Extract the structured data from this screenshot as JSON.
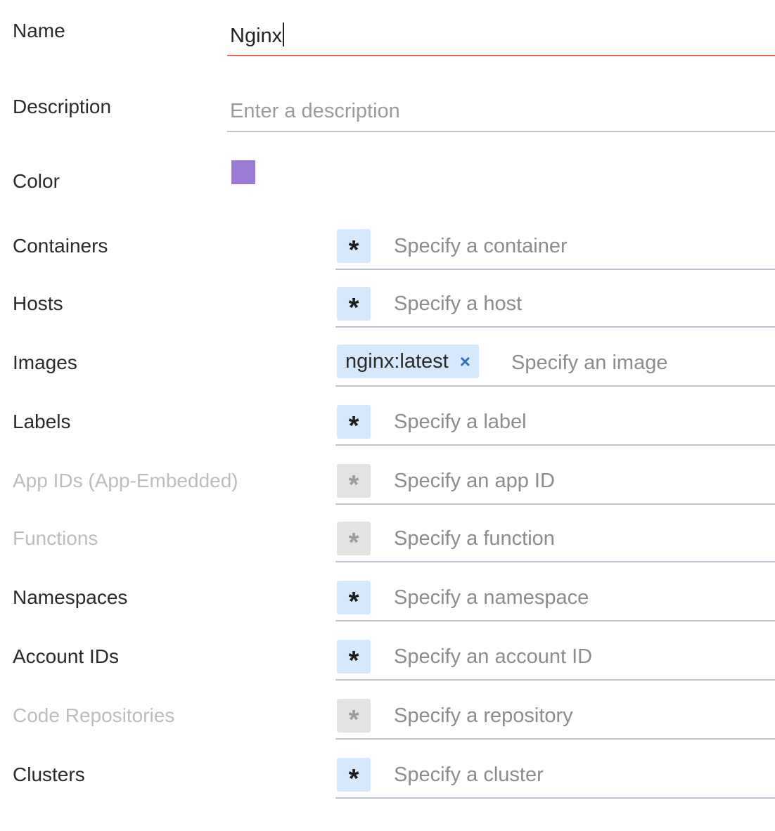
{
  "name": {
    "label": "Name",
    "value": "Nginx"
  },
  "description": {
    "label": "Description",
    "placeholder": "Enter a description"
  },
  "color": {
    "label": "Color",
    "value": "#9b7ad6"
  },
  "scopes": [
    {
      "label": "Containers",
      "placeholder": "Specify a container",
      "wildcard": "*",
      "enabled": true
    },
    {
      "label": "Hosts",
      "placeholder": "Specify a host",
      "wildcard": "*",
      "enabled": true
    },
    {
      "label": "Images",
      "placeholder": "Specify an image",
      "chip": "nginx:latest",
      "chip_remove": "×",
      "enabled": true
    },
    {
      "label": "Labels",
      "placeholder": "Specify a label",
      "wildcard": "*",
      "enabled": true
    },
    {
      "label": "App IDs (App-Embedded)",
      "placeholder": "Specify an app ID",
      "wildcard": "*",
      "enabled": false
    },
    {
      "label": "Functions",
      "placeholder": "Specify a function",
      "wildcard": "*",
      "enabled": false
    },
    {
      "label": "Namespaces",
      "placeholder": "Specify a namespace",
      "wildcard": "*",
      "enabled": true
    },
    {
      "label": "Account IDs",
      "placeholder": "Specify an account ID",
      "wildcard": "*",
      "enabled": true
    },
    {
      "label": "Code Repositories",
      "placeholder": "Specify a repository",
      "wildcard": "*",
      "enabled": false
    },
    {
      "label": "Clusters",
      "placeholder": "Specify a cluster",
      "wildcard": "*",
      "enabled": true
    }
  ]
}
